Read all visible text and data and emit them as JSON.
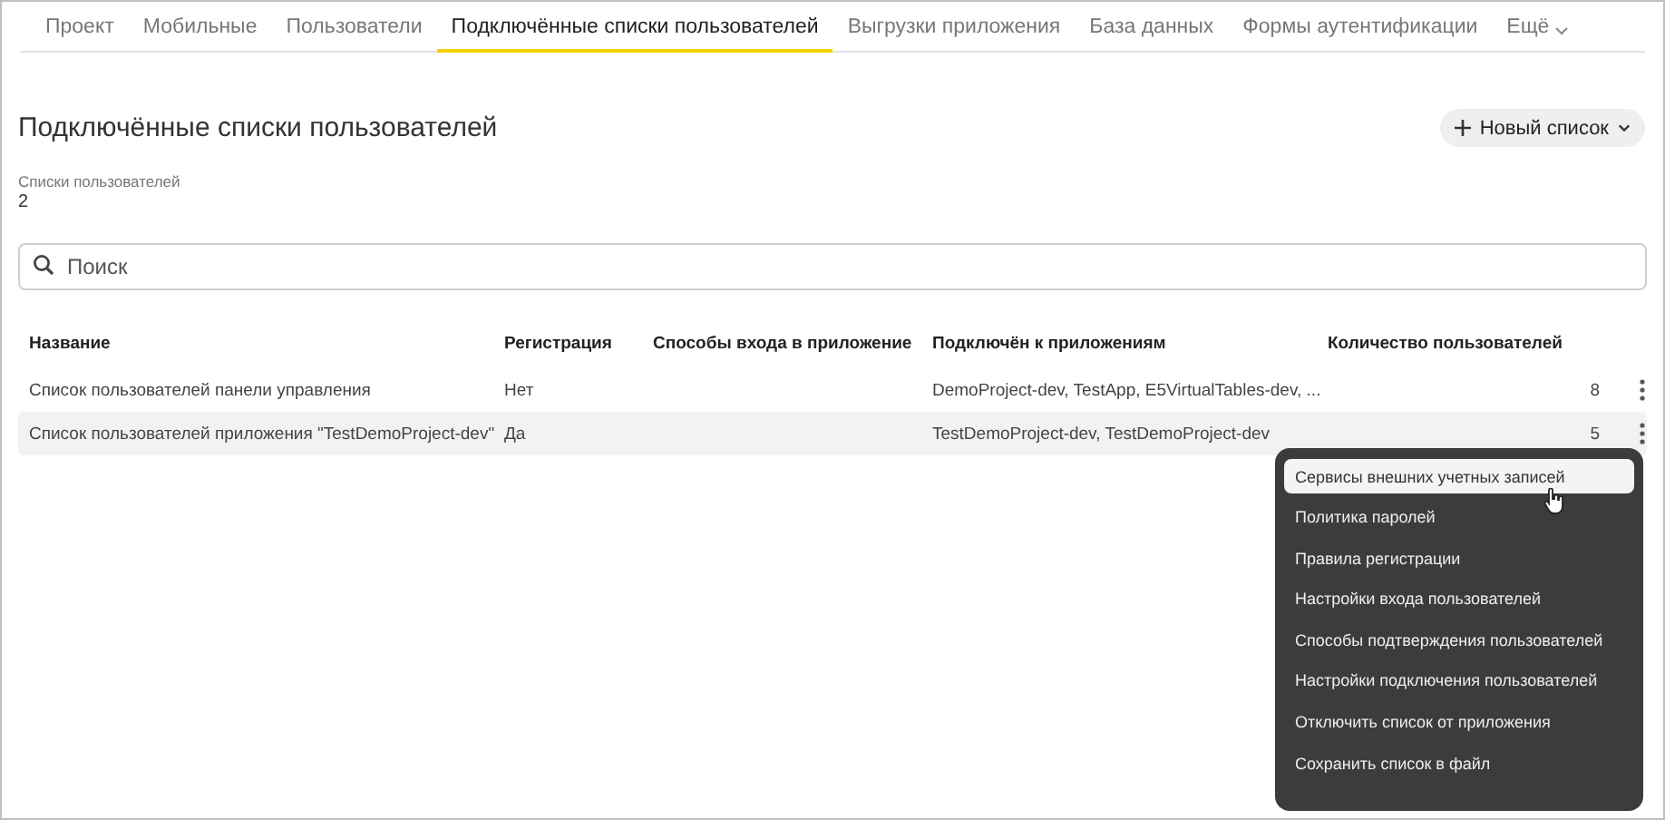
{
  "tabs": [
    {
      "label": "Проект",
      "selected": false
    },
    {
      "label": "Мобильные",
      "selected": false
    },
    {
      "label": "Пользователи",
      "selected": false
    },
    {
      "label": "Подключённые списки пользователей",
      "selected": true
    },
    {
      "label": "Выгрузки приложения",
      "selected": false
    },
    {
      "label": "База данных",
      "selected": false
    },
    {
      "label": "Формы аутентификации",
      "selected": false
    },
    {
      "label": "Ещё",
      "selected": false
    }
  ],
  "page_title": "Подключённые списки пользователей",
  "new_button": {
    "label": "Новый список"
  },
  "summary": {
    "label": "Списки пользователей",
    "value": "2"
  },
  "search": {
    "placeholder": "Поиск"
  },
  "table": {
    "columns": [
      "Название",
      "Регистрация",
      "Способы входа в приложение",
      "Подключён к приложениям",
      "Количество пользователей"
    ],
    "rows": [
      {
        "cells": [
          "Список пользователей панели управления",
          "Нет",
          "",
          "DemoProject-dev, TestApp, E5VirtualTables-dev, ...",
          "8"
        ],
        "selected": false
      },
      {
        "cells": [
          "Список пользователей приложения \"TestDemoProject-dev\"",
          "Да",
          "",
          "TestDemoProject-dev, TestDemoProject-dev",
          "5"
        ],
        "selected": true
      }
    ]
  },
  "menu": {
    "items": [
      {
        "label": "Сервисы внешних учетных записей",
        "selected": true
      },
      {
        "label": "Политика паролей",
        "selected": false
      },
      {
        "label": "Правила регистрации",
        "selected": false
      },
      {
        "label": "Настройки входа пользователей",
        "selected": false
      },
      {
        "label": "Способы подтверждения пользователей",
        "selected": false
      },
      {
        "label": "Настройки подключения пользователей",
        "selected": false
      },
      {
        "label": "Отключить список от приложения",
        "selected": false
      },
      {
        "label": "Сохранить список в файл",
        "selected": false
      }
    ]
  }
}
